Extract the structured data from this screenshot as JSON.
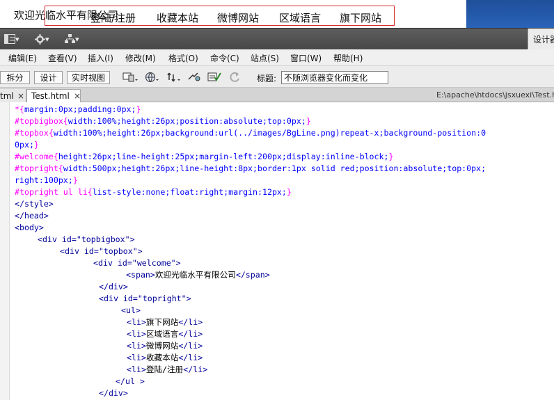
{
  "preview": {
    "welcome": "欢迎光临水平有限公司",
    "nav": [
      "登陆/注册",
      "收藏本站",
      "微博网站",
      "区域语言",
      "旗下网站"
    ]
  },
  "toolbar1": {
    "btn1": "▾",
    "btn2": "▾",
    "btn3": "▾",
    "right_label": "设计器"
  },
  "menu": [
    "编辑(E)",
    "查看(V)",
    "插入(I)",
    "修改(M)",
    "格式(O)",
    "命令(C)",
    "站点(S)",
    "窗口(W)",
    "帮助(H)"
  ],
  "docbar": {
    "views": [
      "拆分",
      "设计",
      "实时视图"
    ],
    "title_label": "标题:",
    "title_value": "不随浏览器变化而变化"
  },
  "tabs": {
    "prev_label": "tml",
    "active_label": "Test.html",
    "close": "×",
    "path": "E:\\apache\\htdocs\\jsxuexi\\Test.h"
  },
  "code": {
    "l1a": "*{",
    "l1b": "margin:0px;padding:0px;",
    "l1c": "}",
    "l2a": "#topbigbox{",
    "l2b": "width:100%;height:26px;position:absolute;top:0px;",
    "l2c": "}",
    "l3a": "#topbox{",
    "l3b": "width:100%;height:26px;background:url(../images/BgLine.png)repeat-x;background-position:0",
    "l4b": "0px;",
    "l4c": "}",
    "l5a": "#welcome{",
    "l5b": "height:26px;line-height:25px;margin-left:200px;display:inline-block;",
    "l5c": "}",
    "l6a": "#topright{",
    "l6b": "width:500px;height:26px;line-height:8px;border:1px solid red;position:absolute;top:0px;",
    "l7b": "right:100px;",
    "l7c": "}",
    "l8a": "#topright ul li{",
    "l8b": "list-style:none;float:right;margin:12px;",
    "l8c": "}",
    "l9": "</style>",
    "l10": "</head>",
    "l11": "<body>",
    "l12": "<div id=\"topbigbox\">",
    "l13": "<div id=\"topbox\">",
    "l14": "<div id=\"welcome\">",
    "l15a": "<span>",
    "l15b": "欢迎光临水平有限公司",
    "l15c": "</span>",
    "l16": "</div>",
    "l17": "<div id=\"topright\">",
    "l18": "<ul>",
    "li_open": "<li>",
    "li_close": "</li>",
    "li1": "旗下网站",
    "li2": "区域语言",
    "li3": "微博网站",
    "li4": "收藏本站",
    "li5": "登陆/注册",
    "l24": "</ul >",
    "l25": "</div>"
  }
}
